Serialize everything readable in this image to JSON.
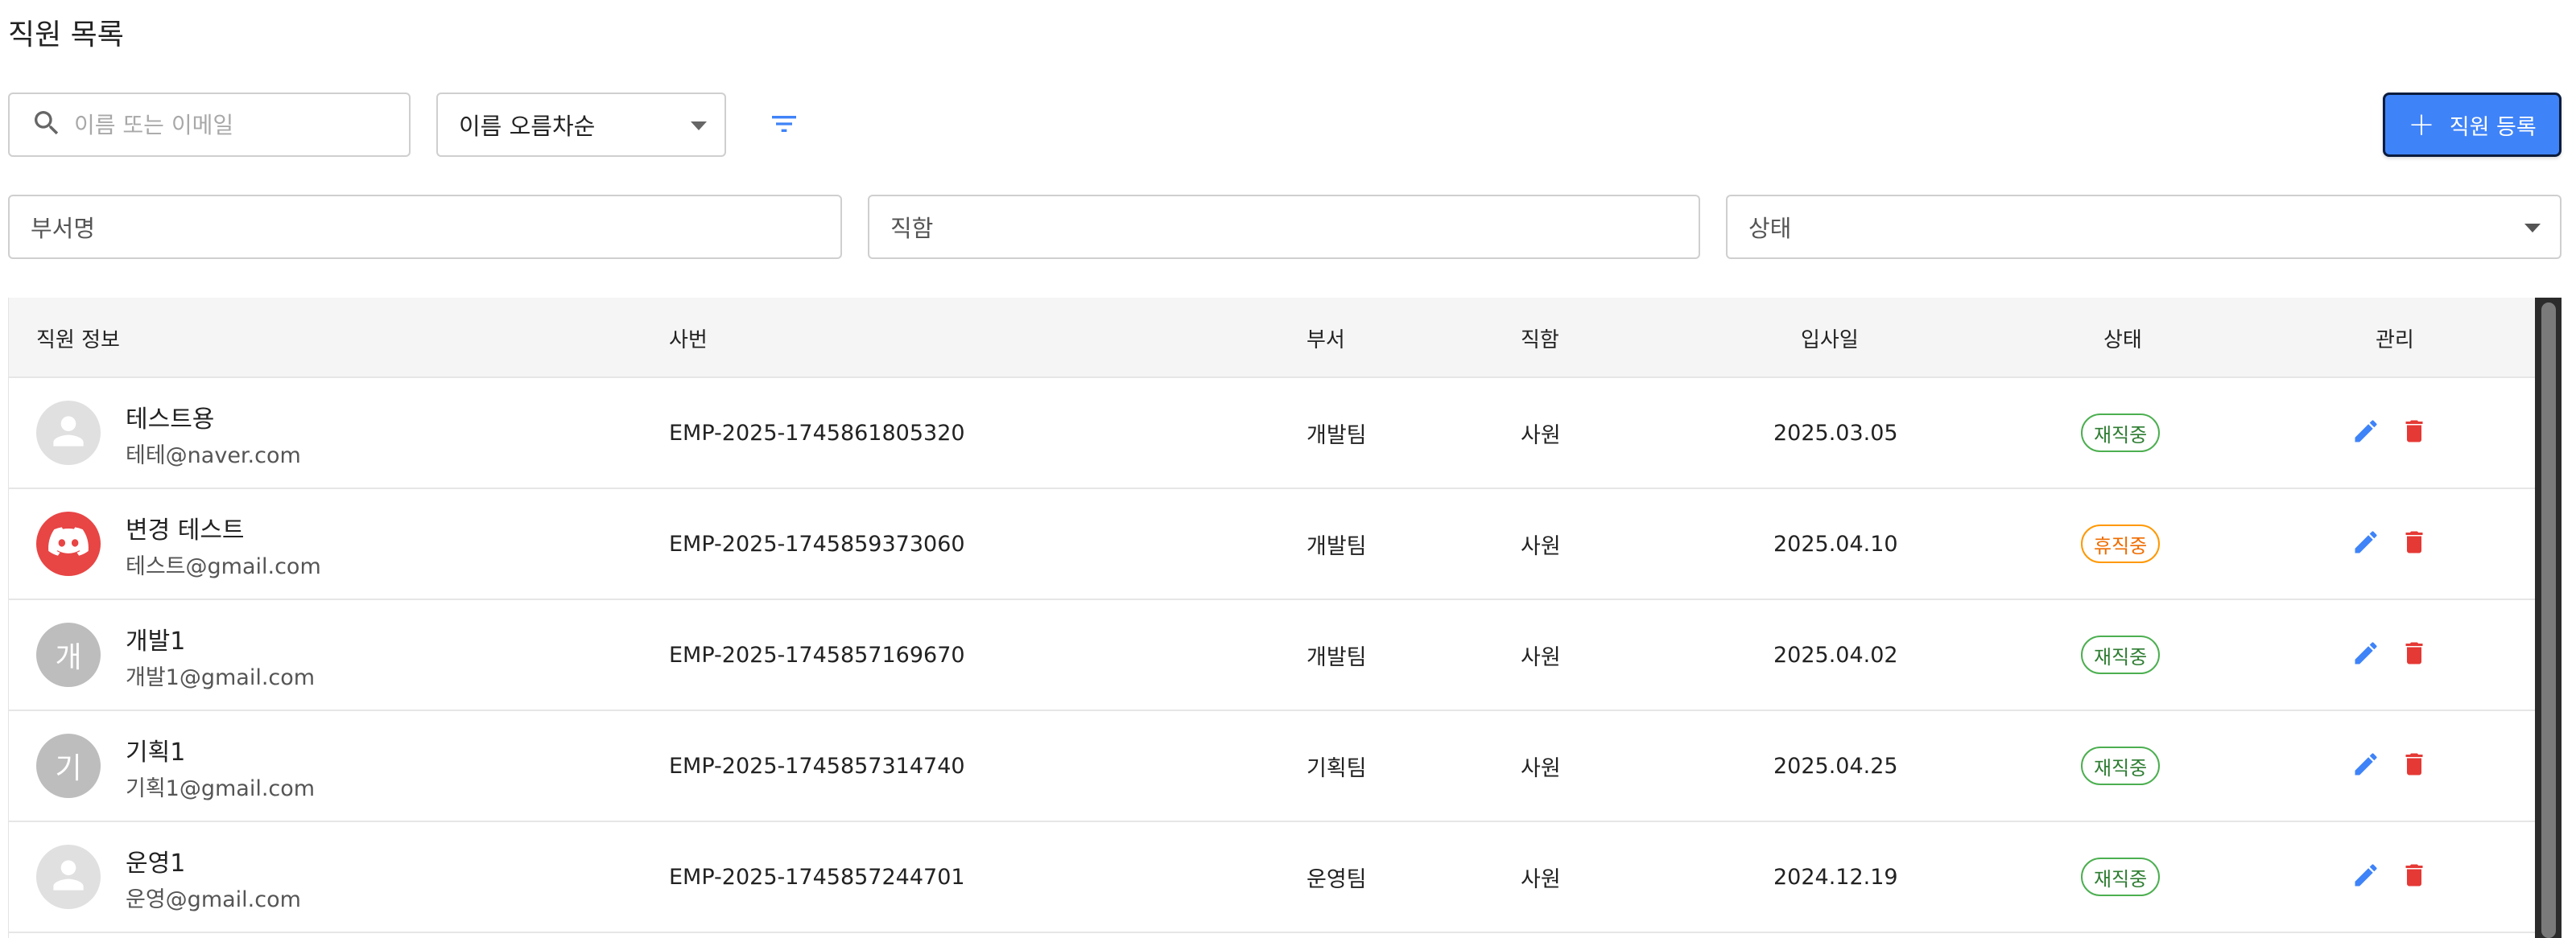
{
  "page": {
    "title": "직원 목록"
  },
  "search": {
    "placeholder": "이름 또는 이메일"
  },
  "sort": {
    "value": "이름 오름차순"
  },
  "toolbar": {
    "add_label": "직원 등록"
  },
  "filters": {
    "department_placeholder": "부서명",
    "position_placeholder": "직함",
    "status_placeholder": "상태"
  },
  "table": {
    "headers": {
      "info": "직원 정보",
      "emp_no": "사번",
      "department": "부서",
      "position": "직함",
      "hire_date": "입사일",
      "status": "상태",
      "manage": "관리"
    },
    "rows": [
      {
        "avatar": "default-person",
        "avatar_text": "",
        "name": "테스트용",
        "email": "테테@naver.com",
        "emp_no": "EMP-2025-1745861805320",
        "department": "개발팀",
        "position": "사원",
        "hire_date": "2025.03.05",
        "status": "재직중",
        "status_type": "active"
      },
      {
        "avatar": "discord-logo",
        "avatar_text": "",
        "name": "변경 테스트",
        "email": "테스트@gmail.com",
        "emp_no": "EMP-2025-1745859373060",
        "department": "개발팀",
        "position": "사원",
        "hire_date": "2025.04.10",
        "status": "휴직중",
        "status_type": "leave"
      },
      {
        "avatar": "initial",
        "avatar_text": "개",
        "name": "개발1",
        "email": "개발1@gmail.com",
        "emp_no": "EMP-2025-1745857169670",
        "department": "개발팀",
        "position": "사원",
        "hire_date": "2025.04.02",
        "status": "재직중",
        "status_type": "active"
      },
      {
        "avatar": "initial",
        "avatar_text": "기",
        "name": "기획1",
        "email": "기획1@gmail.com",
        "emp_no": "EMP-2025-1745857314740",
        "department": "기획팀",
        "position": "사원",
        "hire_date": "2025.04.25",
        "status": "재직중",
        "status_type": "active"
      },
      {
        "avatar": "default-person",
        "avatar_text": "",
        "name": "운영1",
        "email": "운영@gmail.com",
        "emp_no": "EMP-2025-1745857244701",
        "department": "운영팀",
        "position": "사원",
        "hire_date": "2024.12.19",
        "status": "재직중",
        "status_type": "active"
      }
    ]
  },
  "colors": {
    "primary": "#3f83f8",
    "active_status": "#2e7d32",
    "leave_status": "#ef6c00",
    "edit_icon": "#3f83f8",
    "delete_icon": "#e53935"
  }
}
